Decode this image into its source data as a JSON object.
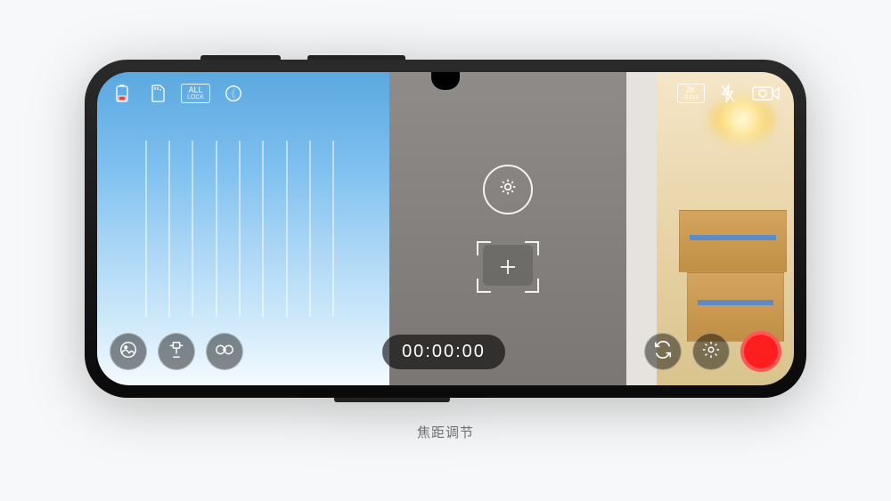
{
  "caption": "焦距调节",
  "topbar": {
    "battery_icon": "battery-icon",
    "card_icon": "sd-card-icon",
    "lock_label": "ALL",
    "lock_sublabel": "LOCK",
    "night_mode_icon": "night-mode-icon",
    "resolution_label": "2K",
    "resolution_sub": "30fps",
    "flash_icon": "flash-off-icon",
    "camera_switch_icon": "rear-camera-icon"
  },
  "center": {
    "exposure_icon": "brightness-icon",
    "focus_icon": "focus-frame-icon"
  },
  "bottombar": {
    "gallery_icon": "gallery-icon",
    "gimbal_icon": "gimbal-icon",
    "mode_icon": "shooting-mode-icon",
    "timer": "00:00:00",
    "switch_icon": "switch-camera-icon",
    "settings_icon": "settings-icon",
    "record_icon": "record-button"
  },
  "colors": {
    "record": "#ff1e1e",
    "battery_low": "#ff3b30"
  }
}
